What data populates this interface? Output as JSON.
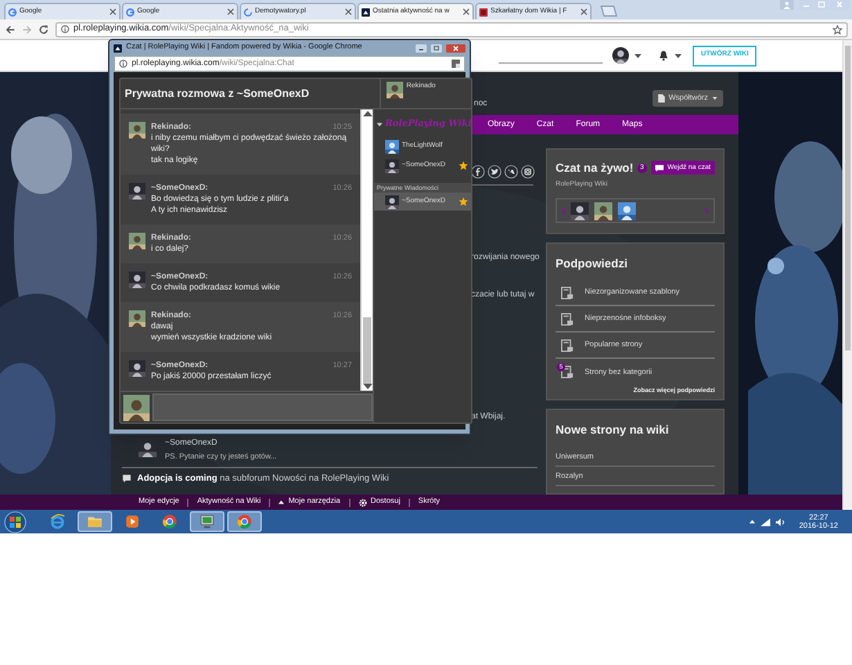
{
  "browser": {
    "tabs": [
      {
        "title": "Google",
        "kind": "google",
        "selected": false
      },
      {
        "title": "Google",
        "kind": "google",
        "selected": false
      },
      {
        "title": "Demotywatory.pl",
        "kind": "loading",
        "selected": false
      },
      {
        "title": "Ostatnia aktywność na w",
        "kind": "wikia",
        "selected": true
      },
      {
        "title": "Szkarłatny dom Wikia | F",
        "kind": "red",
        "selected": false
      }
    ],
    "address": {
      "host": "pl.roleplaying.wikia.com",
      "path": "/wiki/Specjalna:Aktywność_na_wiki"
    }
  },
  "global_nav": {
    "create_button": "UTWÓRZ WIKI"
  },
  "wiki": {
    "nav_fragment": "noc",
    "contribute_button": "Współtwórz",
    "nav": [
      "Obrazy",
      "Czat",
      "Forum",
      "Maps"
    ],
    "text_fragments": [
      "rozwijania nowego",
      "czacie lub tutaj w",
      "at Wbijaj."
    ],
    "activity": {
      "author": "~SomeOnexD",
      "text": "PS. Pytanie czy ty jesteś gotów..."
    },
    "discussion": "**Adopcja is coming** na subforum Nowości na RolePlaying Wiki"
  },
  "chat_module": {
    "title": "Czat na żywo!",
    "count": "3",
    "button": "Wejdź na czat",
    "wiki": "RolePlaying Wiki"
  },
  "tips": {
    "title": "Podpowiedzi",
    "items": [
      {
        "label": "Niezorganizowane szablony"
      },
      {
        "label": "Nieprzenośne infoboksy"
      },
      {
        "label": "Popularne strony"
      },
      {
        "label": "Strony bez kategorii",
        "badge": "5"
      }
    ],
    "more": "Zobacz więcej podpowiedzi"
  },
  "new_pages": {
    "title": "Nowe strony na wiki",
    "items": [
      "Uniwersum",
      "Rozalyn"
    ]
  },
  "wikia_bar": [
    {
      "label": "Moje edycje",
      "kind": "plain"
    },
    {
      "label": "Aktywność na Wiki",
      "kind": "plain"
    },
    {
      "label": "Moje narzędzia",
      "kind": "menu"
    },
    {
      "label": "Dostosuj",
      "kind": "settings"
    },
    {
      "label": "Skróty",
      "kind": "plain"
    }
  ],
  "taskbar": {
    "apps": [
      {
        "kind": "ie",
        "open": false
      },
      {
        "kind": "folder",
        "open": true
      },
      {
        "kind": "media",
        "open": false
      },
      {
        "kind": "chrome",
        "open": false
      },
      {
        "kind": "monitor",
        "open": true
      },
      {
        "kind": "chrome",
        "open": true
      }
    ],
    "time": "22:27",
    "date": "2016-10-12"
  },
  "popup": {
    "title": "Czat | RolePlaying Wiki | Fandom powered by Wikia - Google Chrome",
    "address": {
      "host": "pl.roleplaying.wikia.com",
      "path": "/wiki/Specjalna:Chat"
    },
    "heading": "Prywatna rozmowa z ~SomeOnexD",
    "me": {
      "name": "Rekinado"
    },
    "messages": [
      {
        "author": "Rekinado:",
        "kind": "own",
        "time": "10:25",
        "lines": [
          "i niby czemu miałbym ci podwędzać świeżo założoną",
          "wiki?",
          "tak na logikę"
        ]
      },
      {
        "author": "~SomeOnexD:",
        "kind": "other",
        "time": "10:26",
        "lines": [
          "Bo dowiedzą się o tym ludzie z plitir'a",
          "A ty ich nienawidzisz"
        ]
      },
      {
        "author": "Rekinado:",
        "kind": "own",
        "time": "10:26",
        "lines": [
          "i co dalej?"
        ]
      },
      {
        "author": "~SomeOnexD:",
        "kind": "other",
        "time": "10:26",
        "lines": [
          "Co chwila podkradasz komuś wikie"
        ]
      },
      {
        "author": "Rekinado:",
        "kind": "own",
        "time": "10:26",
        "lines": [
          "dawaj",
          "wymień wszystkie kradzione wiki"
        ]
      },
      {
        "author": "~SomeOnexD:",
        "kind": "other",
        "time": "10:27",
        "lines": [
          "Po jakiś 20000 przestałam liczyć"
        ]
      }
    ],
    "users": {
      "wiki_logo": "RolePlaying Wiki",
      "expanded": true,
      "list": [
        {
          "name": "TheLightWolf",
          "starred": false
        },
        {
          "name": "~SomeOnexD",
          "starred": true
        }
      ],
      "private_title": "Prywatne Wiadomości",
      "private": [
        {
          "name": "~SomeOnexD",
          "starred": true,
          "selected": true
        }
      ]
    }
  }
}
